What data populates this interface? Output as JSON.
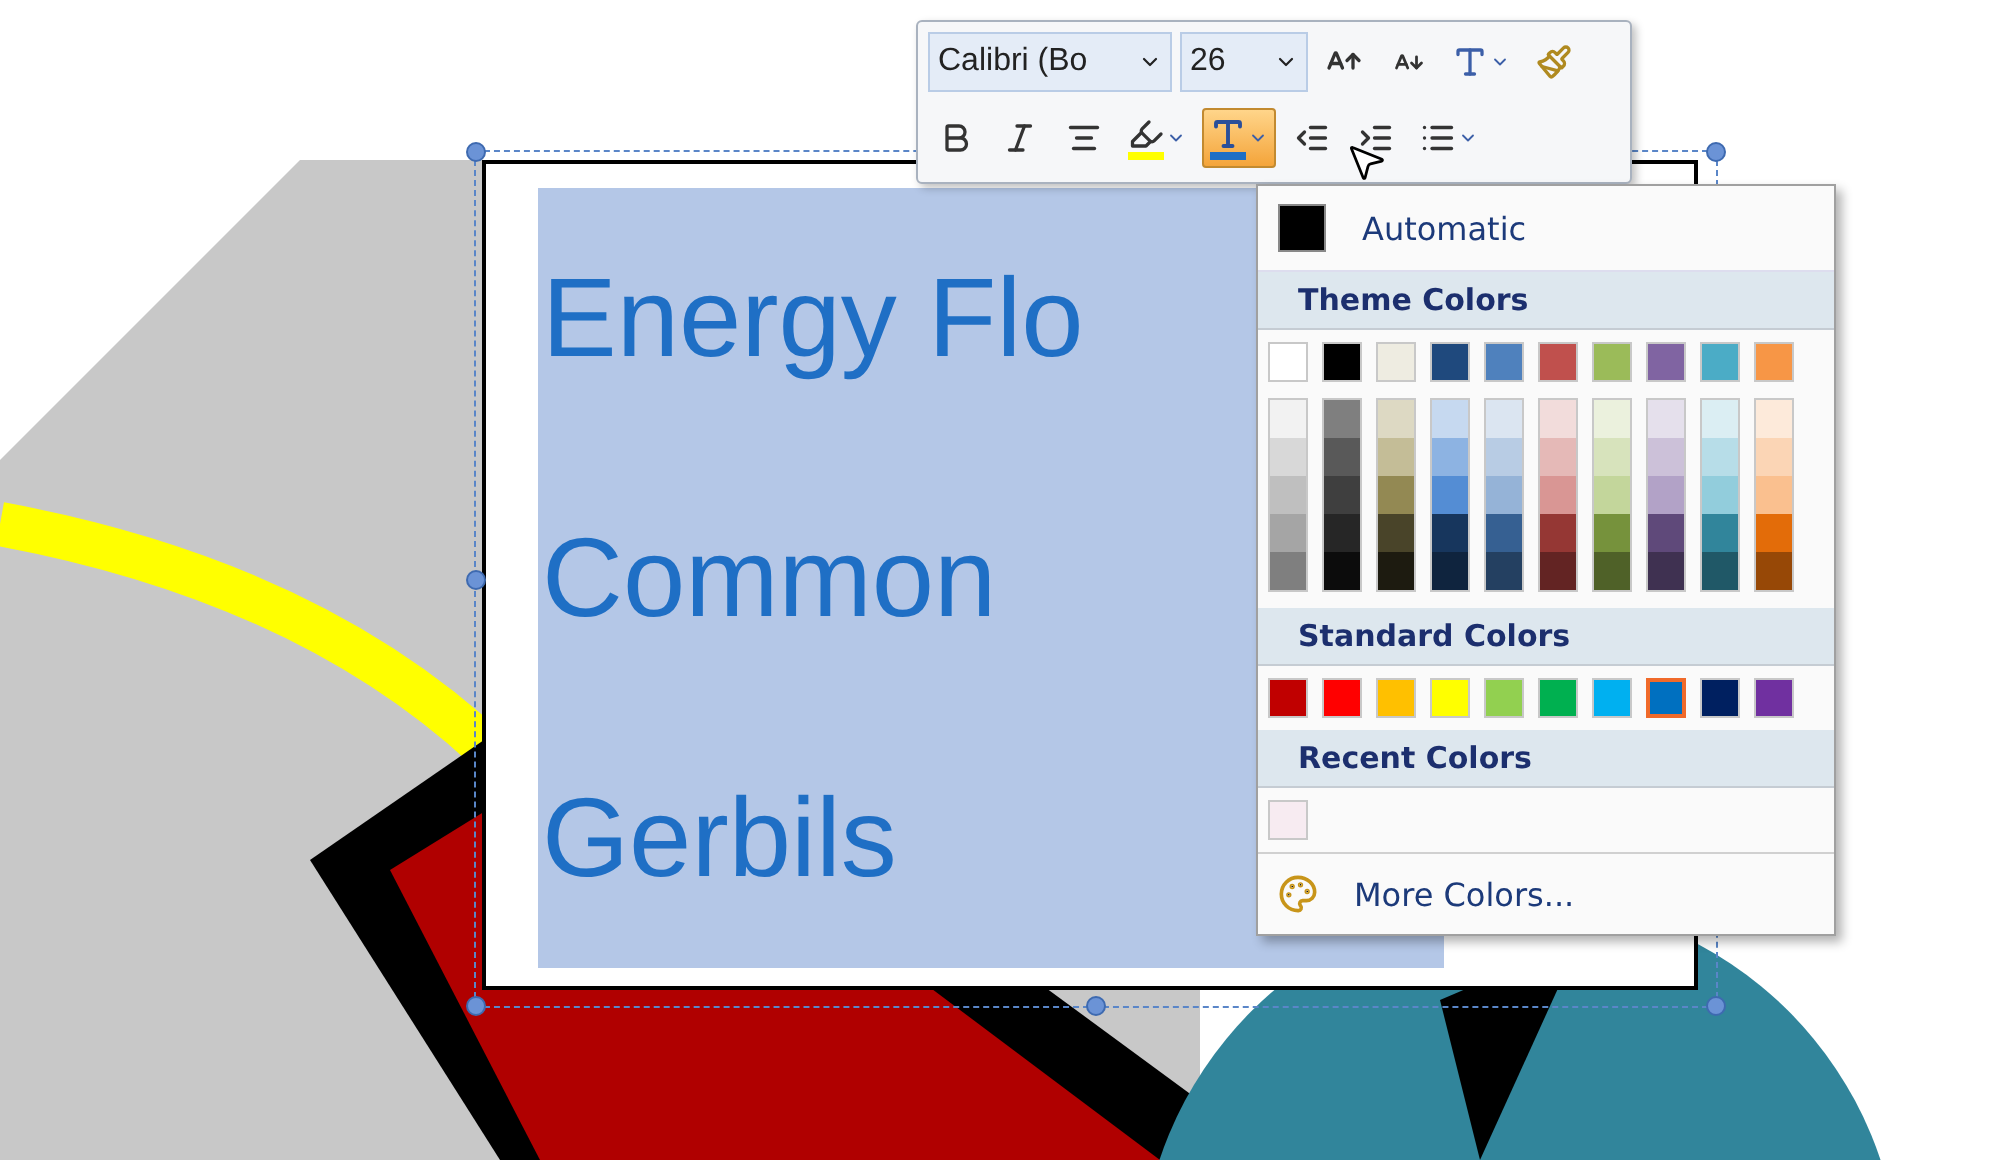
{
  "slide": {
    "lines": [
      {
        "text": "Energy Flo"
      },
      {
        "text": "Common"
      },
      {
        "text": "Gerbils"
      }
    ]
  },
  "mini_toolbar": {
    "font": "Calibri (Bo",
    "size": "26",
    "font_color_active": true
  },
  "color_menu": {
    "automatic": {
      "label": "Automatic",
      "color": "#000000"
    },
    "theme_header": "Theme Colors",
    "theme_colors": [
      {
        "color": "#ffffff"
      },
      {
        "color": "#000000"
      },
      {
        "color": "#eeece1"
      },
      {
        "color": "#1f497d"
      },
      {
        "color": "#4f81bd"
      },
      {
        "color": "#c0504d"
      },
      {
        "color": "#9bbb59"
      },
      {
        "color": "#8064a2"
      },
      {
        "color": "#4bacc6"
      },
      {
        "color": "#f79646"
      }
    ],
    "theme_shades": [
      {
        "shades": [
          {
            "color": "#f2f2f2"
          },
          {
            "color": "#d8d8d8"
          },
          {
            "color": "#bfbfbf"
          },
          {
            "color": "#a5a5a5"
          },
          {
            "color": "#7f7f7f"
          }
        ]
      },
      {
        "shades": [
          {
            "color": "#7f7f7f"
          },
          {
            "color": "#595959"
          },
          {
            "color": "#3f3f3f"
          },
          {
            "color": "#262626"
          },
          {
            "color": "#0c0c0c"
          }
        ]
      },
      {
        "shades": [
          {
            "color": "#ddd9c3"
          },
          {
            "color": "#c4bd97"
          },
          {
            "color": "#938953"
          },
          {
            "color": "#494429"
          },
          {
            "color": "#1d1b10"
          }
        ]
      },
      {
        "shades": [
          {
            "color": "#c6d9f0"
          },
          {
            "color": "#8db3e2"
          },
          {
            "color": "#548dd4"
          },
          {
            "color": "#17365d"
          },
          {
            "color": "#0f243e"
          }
        ]
      },
      {
        "shades": [
          {
            "color": "#dbe5f1"
          },
          {
            "color": "#b8cce4"
          },
          {
            "color": "#95b3d7"
          },
          {
            "color": "#366092"
          },
          {
            "color": "#244061"
          }
        ]
      },
      {
        "shades": [
          {
            "color": "#f2dcdb"
          },
          {
            "color": "#e5b9b7"
          },
          {
            "color": "#d99694"
          },
          {
            "color": "#953734"
          },
          {
            "color": "#632423"
          }
        ]
      },
      {
        "shades": [
          {
            "color": "#ebf1dd"
          },
          {
            "color": "#d7e3bc"
          },
          {
            "color": "#c3d69b"
          },
          {
            "color": "#76923c"
          },
          {
            "color": "#4f6128"
          }
        ]
      },
      {
        "shades": [
          {
            "color": "#e5e0ec"
          },
          {
            "color": "#ccc1d9"
          },
          {
            "color": "#b2a2c7"
          },
          {
            "color": "#5f497a"
          },
          {
            "color": "#3f3151"
          }
        ]
      },
      {
        "shades": [
          {
            "color": "#dbeef3"
          },
          {
            "color": "#b7dde8"
          },
          {
            "color": "#92cddc"
          },
          {
            "color": "#31859b"
          },
          {
            "color": "#205867"
          }
        ]
      },
      {
        "shades": [
          {
            "color": "#fdeada"
          },
          {
            "color": "#fbd5b5"
          },
          {
            "color": "#fac08f"
          },
          {
            "color": "#e36c09"
          },
          {
            "color": "#974806"
          }
        ]
      }
    ],
    "standard_header": "Standard Colors",
    "standard_colors": [
      {
        "color": "#c00000",
        "selected": false
      },
      {
        "color": "#ff0000",
        "selected": false
      },
      {
        "color": "#ffc000",
        "selected": false
      },
      {
        "color": "#ffff00",
        "selected": false
      },
      {
        "color": "#92d050",
        "selected": false
      },
      {
        "color": "#00b050",
        "selected": false
      },
      {
        "color": "#00b0f0",
        "selected": false
      },
      {
        "color": "#0070c0",
        "selected": true
      },
      {
        "color": "#002060",
        "selected": false
      },
      {
        "color": "#7030a0",
        "selected": false
      }
    ],
    "recent_header": "Recent Colors",
    "recent_colors": [
      {
        "color": "#f7ebf1"
      }
    ],
    "more": "More Colors..."
  }
}
